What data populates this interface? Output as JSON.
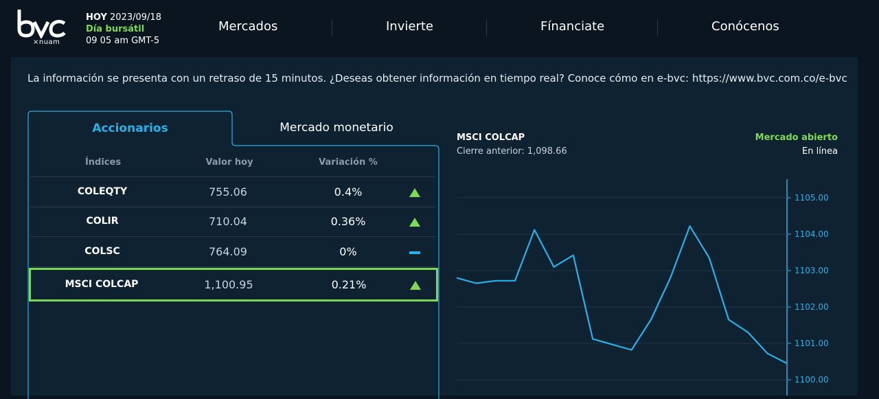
{
  "header": {
    "logo_text": "bvc",
    "logo_tag": "×nuam",
    "status_hoy": "HOY",
    "status_date": "2023/09/18",
    "status_day": "Día bursátil",
    "status_time": "09 05 am GMT-5",
    "nav": [
      "Mercados",
      "Invierte",
      "Fínanciate",
      "Conócenos"
    ]
  },
  "notice": "La información se presenta con un retraso de 15 minutos. ¿Deseas obtener información en tiempo real? Conoce cómo en e-bvc: https://www.bvc.com.co/e-bvc",
  "tabs": {
    "active": "Accionarios",
    "inactive": "Mercado monetario"
  },
  "table": {
    "headers": [
      "Índices",
      "Valor hoy",
      "Variación %"
    ],
    "rows": [
      {
        "name": "COLEQTY",
        "value": "755.06",
        "variation": "0.4%",
        "trend": "up"
      },
      {
        "name": "COLIR",
        "value": "710.04",
        "variation": "0.36%",
        "trend": "up"
      },
      {
        "name": "COLSC",
        "value": "764.09",
        "variation": "0%",
        "trend": "flat"
      },
      {
        "name": "MSCI COLCAP",
        "value": "1,100.95",
        "variation": "0.21%",
        "trend": "up"
      }
    ]
  },
  "chart_panel": {
    "title": "MSCI COLCAP",
    "prev_close": "Cierre anterior: 1,098.66",
    "market_status": "Mercado abierto",
    "connection": "En línea"
  },
  "colors": {
    "accent": "#2ab0e8",
    "positive": "#7ed957",
    "background": "#0a1520",
    "panel": "#0f2232"
  },
  "chart_data": {
    "type": "line",
    "series": [
      {
        "values": [
          1102.8,
          1102.65,
          1102.72,
          1102.72,
          1104.12,
          1103.1,
          1103.42,
          1101.12,
          1100.97,
          1100.82,
          1101.65,
          1102.8,
          1104.22,
          1103.35,
          1101.65,
          1101.3,
          1100.72,
          1100.45
        ]
      }
    ],
    "yticks": [
      "1105.00",
      "1104.00",
      "1103.00",
      "1102.00",
      "1101.00",
      "1100.00"
    ],
    "ylim": [
      1099.8,
      1105.5
    ],
    "grid": true
  }
}
